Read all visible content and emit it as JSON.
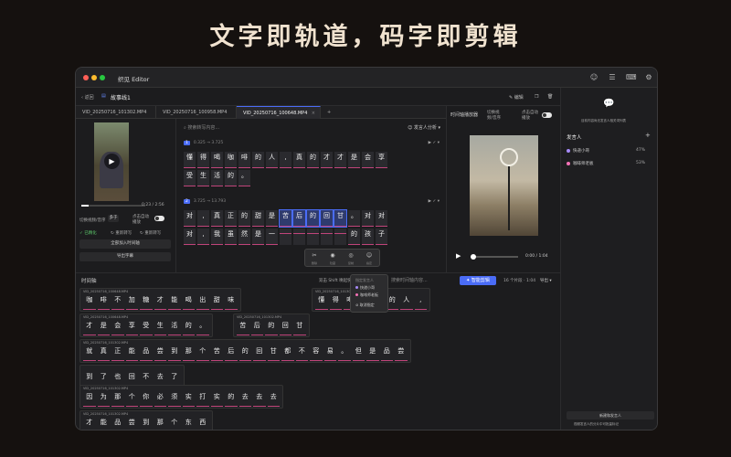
{
  "hero_title": "文字即轨道，码字即剪辑",
  "app": {
    "title": "织见 Editor",
    "back": "返回",
    "project": "故事线1",
    "edit": "编辑"
  },
  "tabs": [
    "VID_20250716_101302.MP4",
    "VID_20250716_100958.MP4",
    "VID_20250716_100648.MP4"
  ],
  "left": {
    "time": "0:23 / 2:56",
    "mode": "切换视频/音序",
    "mode_btn": "多于",
    "autoplay": "点击自动播放",
    "btn1": "已精化",
    "btn2": "重新转写",
    "btn3": "重新转写",
    "add_timeline": "全部加入时间轴",
    "export": "导出字幕"
  },
  "mid": {
    "search_placeholder": "搜索转写内容...",
    "speaker_btn": "发言人分析",
    "seg1": {
      "num": "1",
      "time": "0.325 → 3.725",
      "row1": [
        "懂",
        "得",
        "喝",
        "咖",
        "啡",
        "的",
        "人",
        ",",
        "真",
        "的",
        "才",
        "才",
        "是",
        "会",
        "享"
      ],
      "row2": [
        "受",
        "生",
        "活",
        "的",
        "。"
      ]
    },
    "seg2": {
      "num": "2",
      "time": "3.725 → 13.793",
      "row1": [
        "对",
        ",",
        "真",
        "正",
        "的",
        "甜",
        "是",
        "苦",
        "后",
        "的",
        "回",
        "甘",
        "。",
        "对",
        "对"
      ],
      "row2": [
        "对",
        ",",
        "我",
        "虽",
        "然",
        "是",
        "一",
        "",
        "",
        "",
        "",
        "",
        "的",
        "孩",
        "子"
      ]
    }
  },
  "popup": {
    "items": [
      "删除",
      "隐藏",
      "复制",
      "指定"
    ],
    "submenu_title": "指定发言人",
    "speakers": [
      "快递小哥",
      "咖啡师老板"
    ],
    "cancel": "取消指定"
  },
  "preview": {
    "label": "时间轴播放器",
    "toggle1": "切换视频/音序",
    "toggle2": "点击自动播放",
    "time": "0:00 / 1:04"
  },
  "timeline": {
    "title": "时间轴",
    "hint": "双击 Shift 唤起快...",
    "search": "搜索时间轴内容...",
    "smart": "智能剪辑",
    "count": "16 个片段 · 1:04",
    "export": "导出",
    "clips": [
      {
        "name": "VID_20250716_100648.MP4",
        "words": [
          "咖",
          "啡",
          "不",
          "加",
          "糖",
          "才",
          "能",
          "喝",
          "出",
          "甜",
          "味"
        ]
      },
      {
        "name": "VID_20250716_101302.MP4",
        "words": [
          "懂",
          "得",
          "喝",
          "咖",
          "啡",
          "的",
          "人",
          ","
        ]
      },
      {
        "name": "VID_20250716_100648.MP4",
        "words": [
          "才",
          "是",
          "会",
          "享",
          "受",
          "生",
          "活",
          "的",
          "。"
        ]
      },
      {
        "name": "VID_20250716_101302.MP4",
        "words": [
          "苦",
          "后",
          "的",
          "回",
          "甘"
        ]
      },
      {
        "name": "VID_20250716_101302.MP4",
        "words": [
          "就",
          "真",
          "正",
          "能",
          "品",
          "尝",
          "到",
          "那",
          "个",
          "苦",
          "后",
          "的",
          "回",
          "甘",
          "都",
          "不",
          "容",
          "易",
          "。",
          "但",
          "是",
          "品",
          "尝"
        ]
      },
      {
        "name": "",
        "words": [
          "到",
          "了",
          "也",
          "回",
          "不",
          "去",
          "了"
        ]
      },
      {
        "name": "VID_20250716_101302.MP4",
        "words": [
          "因",
          "为",
          "那",
          "个",
          "你",
          "必",
          "须",
          "实",
          "打",
          "实",
          "的",
          "去",
          "去",
          "去"
        ]
      },
      {
        "name": "VID_20250716_101302.MP4",
        "words": [
          "才",
          "能",
          "品",
          "尝",
          "到",
          "那",
          "个",
          "东",
          "西"
        ]
      }
    ]
  },
  "sidebar": {
    "empty": "目前内容尚无发言人相关词列表",
    "header": "发言人",
    "speakers": [
      {
        "name": "快递小哥",
        "pct": "47%",
        "color": "#a78bfa"
      },
      {
        "name": "咖啡师老板",
        "pct": "53%",
        "color": "#f472b6"
      }
    ],
    "bottom1": "新建和发言人",
    "bottom2": "视频发言人的分片中可批量标记"
  }
}
